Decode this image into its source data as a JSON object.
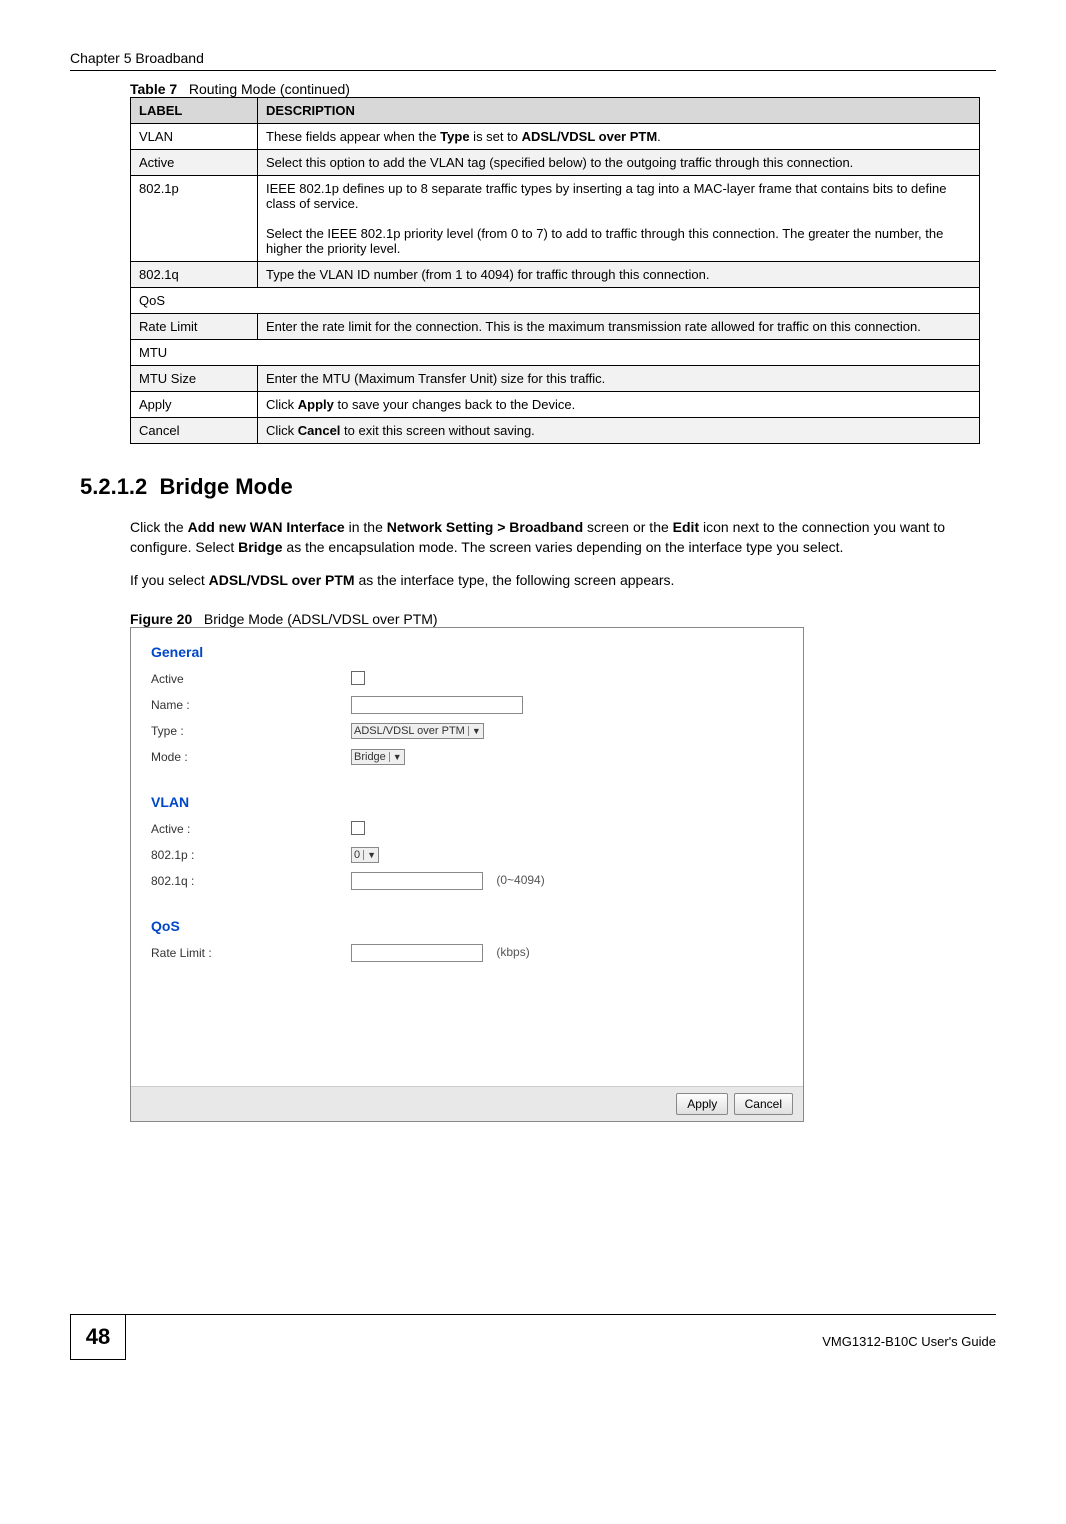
{
  "header": {
    "chapter": "Chapter 5 Broadband"
  },
  "table": {
    "caption_no": "Table 7",
    "caption_text": "Routing Mode (continued)",
    "head_label": "LABEL",
    "head_desc": "DESCRIPTION",
    "rows": [
      {
        "label": "VLAN",
        "desc": "These fields appear when the Type is set to ADSL/VDSL over PTM."
      },
      {
        "label": "Active",
        "desc": "Select this option to add the VLAN tag (specified below) to the outgoing traffic through this connection."
      },
      {
        "label": "802.1p",
        "desc": "IEEE 802.1p defines up to 8 separate traffic types by inserting a tag into a MAC-layer frame that contains bits to define class of service.\n\nSelect the IEEE 802.1p priority level (from 0 to 7) to add to traffic through this connection. The greater the number, the higher the priority level."
      },
      {
        "label": "802.1q",
        "desc": "Type the VLAN ID number (from 1 to 4094) for traffic through this connection."
      },
      {
        "label": "QoS",
        "desc": ""
      },
      {
        "label": "Rate Limit",
        "desc": "Enter the rate limit for the connection. This is the maximum transmission rate allowed for traffic on this connection."
      },
      {
        "label": "MTU",
        "desc": ""
      },
      {
        "label": "MTU Size",
        "desc": "Enter the MTU (Maximum Transfer Unit) size for this traffic."
      },
      {
        "label": "Apply",
        "desc": "Click Apply to save your changes back to the Device."
      },
      {
        "label": "Cancel",
        "desc": "Click Cancel to exit this screen without saving."
      }
    ]
  },
  "section": {
    "number": "5.2.1.2",
    "title": "Bridge Mode",
    "para1": "Click the Add new WAN Interface in the Network Setting > Broadband screen or the Edit icon next to the connection you want to configure. Select Bridge as the encapsulation mode. The screen varies depending on the interface type you select.",
    "para2": "If you select ADSL/VDSL over PTM as the interface type, the following screen appears."
  },
  "figure": {
    "no": "Figure 20",
    "caption": "Bridge Mode (ADSL/VDSL over PTM)",
    "general_head": "General",
    "vlan_head": "VLAN",
    "qos_head": "QoS",
    "labels": {
      "active": "Active",
      "name": "Name :",
      "type": "Type :",
      "mode": "Mode :",
      "active2": "Active :",
      "p8021p": "802.1p :",
      "p8021q": "802.1q :",
      "rate": "Rate Limit :"
    },
    "values": {
      "type_sel": "ADSL/VDSL over PTM",
      "mode_sel": "Bridge",
      "p_sel": "0",
      "q_hint": "(0~4094)",
      "rate_hint": "(kbps)"
    },
    "buttons": {
      "apply": "Apply",
      "cancel": "Cancel"
    }
  },
  "footer": {
    "page": "48",
    "guide": "VMG1312-B10C User's Guide"
  }
}
